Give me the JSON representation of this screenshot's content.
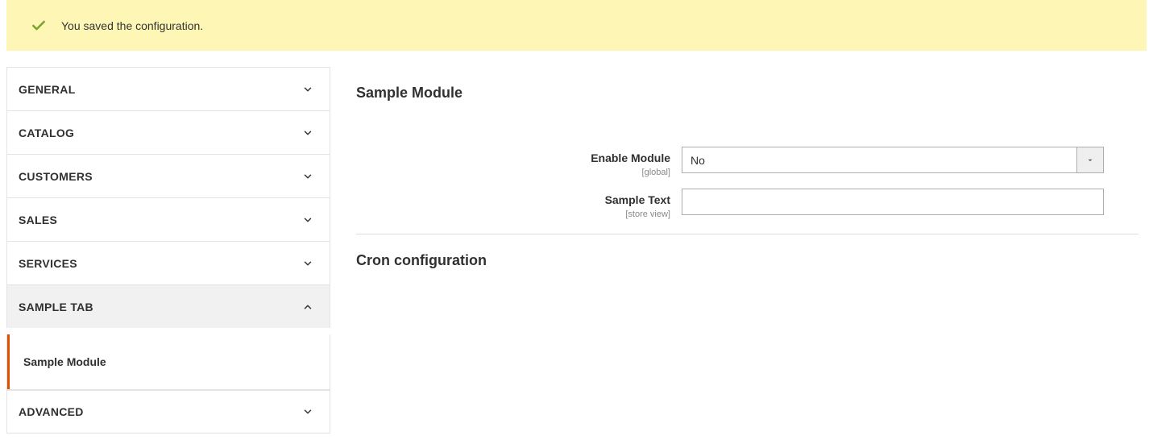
{
  "message": {
    "text": "You saved the configuration."
  },
  "sidebar": {
    "sections": [
      {
        "label": "GENERAL",
        "expanded": false
      },
      {
        "label": "CATALOG",
        "expanded": false
      },
      {
        "label": "CUSTOMERS",
        "expanded": false
      },
      {
        "label": "SALES",
        "expanded": false
      },
      {
        "label": "SERVICES",
        "expanded": false
      },
      {
        "label": "SAMPLE TAB",
        "expanded": true,
        "sub": {
          "label": "Sample Module"
        }
      },
      {
        "label": "ADVANCED",
        "expanded": false
      }
    ]
  },
  "main": {
    "section1_title": "Sample Module",
    "enable_module": {
      "label": "Enable Module",
      "scope": "[global]",
      "value": "No"
    },
    "sample_text": {
      "label": "Sample Text",
      "scope": "[store view]",
      "value": ""
    },
    "section2_title": "Cron configuration"
  }
}
